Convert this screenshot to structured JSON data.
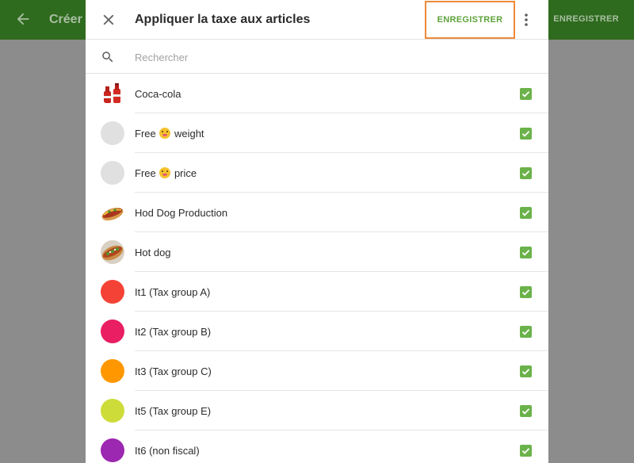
{
  "background": {
    "title": "Créer u",
    "save_label": "ENREGISTRER"
  },
  "dialog": {
    "title": "Appliquer la taxe aux articles",
    "save_label": "ENREGISTRER",
    "search_placeholder": "Rechercher"
  },
  "items": [
    {
      "label": "Coca-cola",
      "thumb": "cola-bottles-image",
      "checked": true
    },
    {
      "label_before": "Free ",
      "label_after": " weight",
      "emoji": "tongue-wink-emoji",
      "thumb": "gray-circle",
      "checked": true
    },
    {
      "label_before": "Free ",
      "label_after": " price",
      "emoji": "tongue-wink-emoji",
      "thumb": "gray-circle",
      "checked": true
    },
    {
      "label": "Hod Dog Production",
      "thumb": "hot-dog-image",
      "checked": true
    },
    {
      "label": "Hot dog",
      "thumb": "hot-dog-image",
      "checked": true
    },
    {
      "label": "It1 (Tax group A)",
      "color": "#f44336",
      "checked": true
    },
    {
      "label": "It2 (Tax group B)",
      "color": "#e91e63",
      "checked": true
    },
    {
      "label": "It3 (Tax group C)",
      "color": "#ff9800",
      "checked": true
    },
    {
      "label": "It5 (Tax group E)",
      "color": "#cddc39",
      "checked": true
    },
    {
      "label": "It6 (non fiscal)",
      "color": "#9c27b0",
      "checked": true
    }
  ],
  "colors": {
    "appbar": "#2f6b1e",
    "accent_green": "#5ea33a",
    "checkbox": "#6bb24a",
    "highlight_border": "#ee8a3a",
    "placeholder_thumb": "#e0e0e0"
  }
}
